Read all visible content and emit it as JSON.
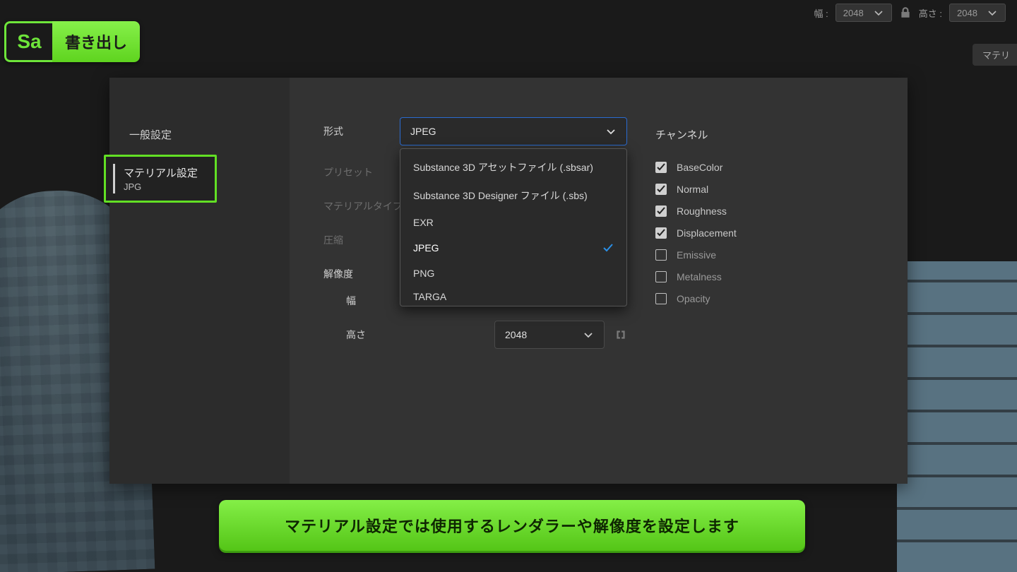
{
  "topbar": {
    "width_label": "幅 :",
    "width_value": "2048",
    "height_label": "高さ :",
    "height_value": "2048"
  },
  "float_tab": "マテリ",
  "badge": {
    "code": "Sa",
    "title": "書き出し"
  },
  "sidebar": {
    "items": [
      {
        "label": "一般設定"
      },
      {
        "label": "マテリアル設定",
        "sub": "JPG"
      }
    ]
  },
  "form": {
    "format_label": "形式",
    "format_value": "JPEG",
    "preset_label": "プリセット",
    "material_type_label": "マテリアルタイプ",
    "compression_label": "圧縮",
    "resolution_label": "解像度",
    "width_label": "幅",
    "height_label": "高さ",
    "height_value": "2048"
  },
  "format_options": [
    {
      "label": "Substance 3D アセットファイル (.sbsar)"
    },
    {
      "label": "Substance 3D Designer ファイル (.sbs)"
    },
    {
      "label": "EXR"
    },
    {
      "label": "JPEG",
      "selected": true
    },
    {
      "label": "PNG"
    },
    {
      "label": "TARGA"
    }
  ],
  "channels": {
    "title": "チャンネル",
    "items": [
      {
        "label": "BaseColor",
        "on": true
      },
      {
        "label": "Normal",
        "on": true
      },
      {
        "label": "Roughness",
        "on": true
      },
      {
        "label": "Displacement",
        "on": true
      },
      {
        "label": "Emissive",
        "on": false
      },
      {
        "label": "Metalness",
        "on": false
      },
      {
        "label": "Opacity",
        "on": false
      }
    ]
  },
  "caption": "マテリアル設定では使用するレンダラーや解像度を設定します"
}
